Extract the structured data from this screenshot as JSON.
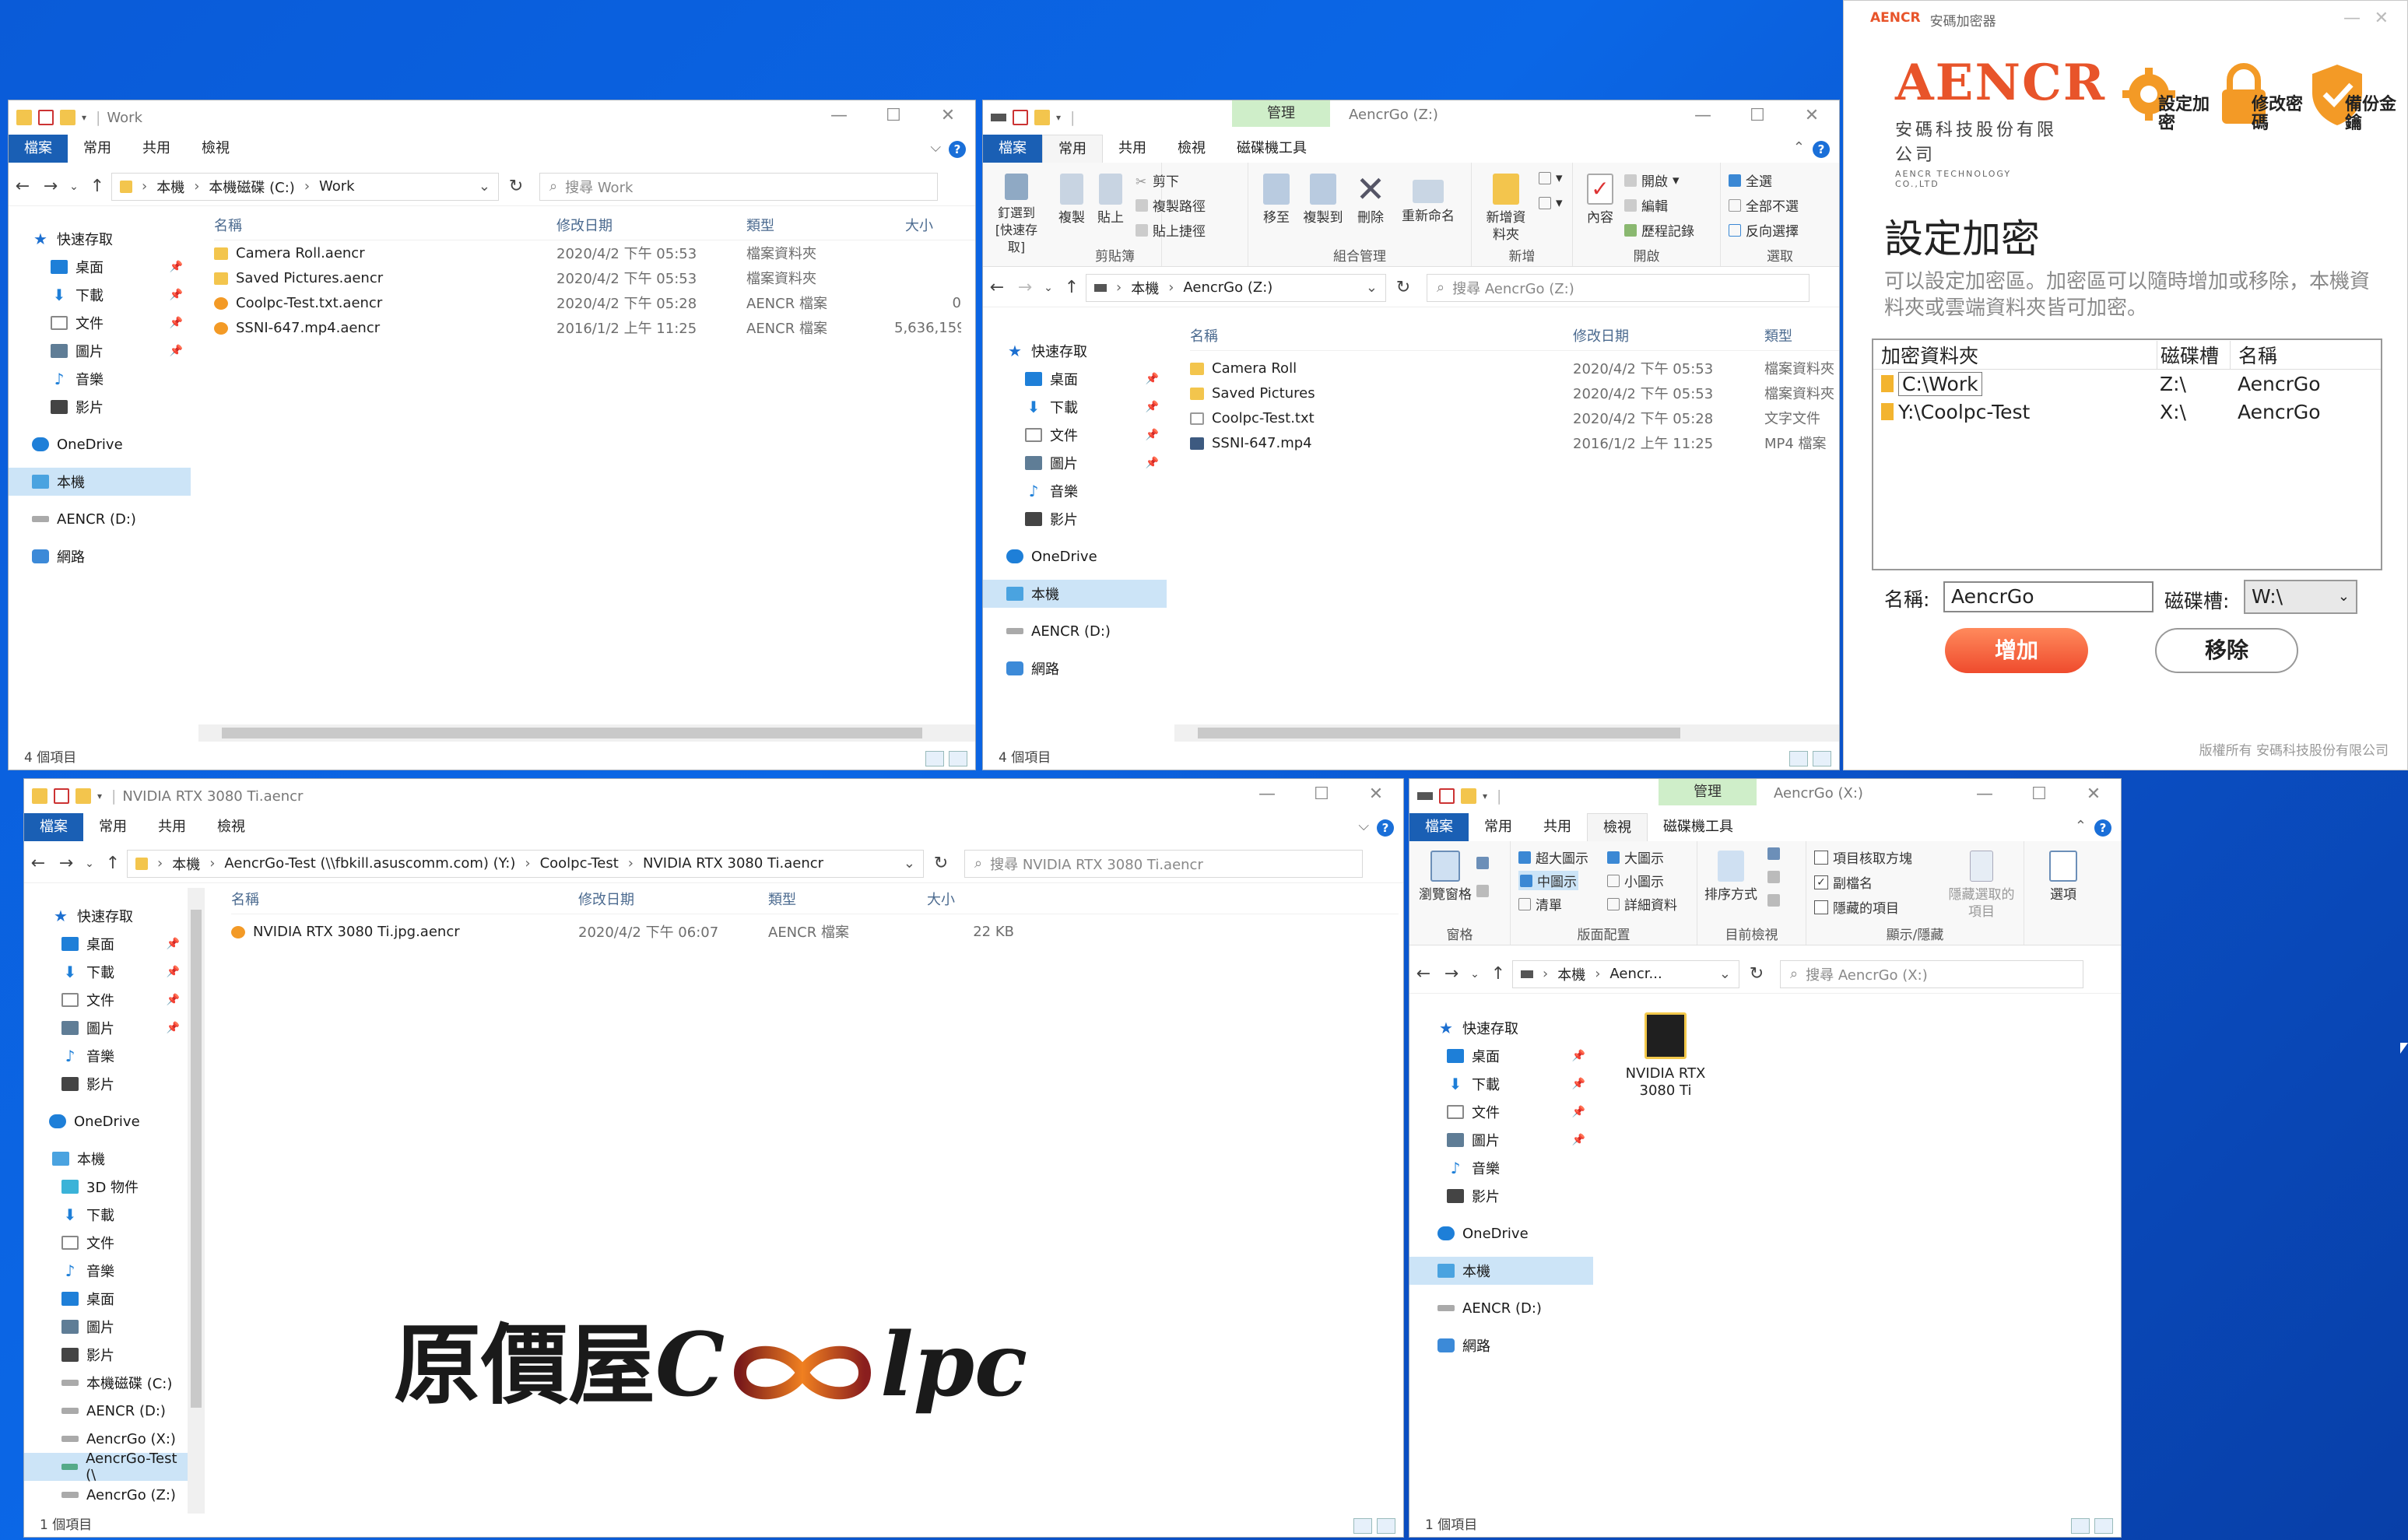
{
  "common": {
    "tab_file": "檔案",
    "tab_home": "常用",
    "tab_share": "共用",
    "tab_view": "檢視",
    "manage": "管理",
    "drive_tools": "磁碟機工具",
    "col_name": "名稱",
    "col_date": "修改日期",
    "col_type": "類型",
    "col_size": "大小",
    "nav_quick": "快速存取",
    "nav_desktop": "桌面",
    "nav_downloads": "下載",
    "nav_docs": "文件",
    "nav_pics": "圖片",
    "nav_music": "音樂",
    "nav_videos": "影片",
    "nav_onedrive": "OneDrive",
    "nav_pc": "本機",
    "nav_aencr_d": "AENCR (D:)",
    "nav_network": "網路",
    "items4": "4 個項目",
    "items1": "1 個項目"
  },
  "win1": {
    "title": "Work",
    "breadcrumb": [
      "本機",
      "本機磁碟 (C:)",
      "Work"
    ],
    "search_placeholder": "搜尋 Work",
    "files": [
      {
        "name": "Camera Roll.aencr",
        "date": "2020/4/2 下午 05:53",
        "type": "檔案資料夾",
        "size": "",
        "icon": "folder"
      },
      {
        "name": "Saved Pictures.aencr",
        "date": "2020/4/2 下午 05:53",
        "type": "檔案資料夾",
        "size": "",
        "icon": "folder"
      },
      {
        "name": "Coolpc-Test.txt.aencr",
        "date": "2020/4/2 下午 05:28",
        "type": "AENCR 檔案",
        "size": "0",
        "icon": "aen"
      },
      {
        "name": "SSNI-647.mp4.aencr",
        "date": "2016/1/2 上午 11:25",
        "type": "AENCR 檔案",
        "size": "5,636,159",
        "icon": "aen"
      }
    ]
  },
  "win2": {
    "title": "AencrGo (Z:)",
    "breadcrumb": [
      "本機",
      "AencrGo (Z:)"
    ],
    "search_placeholder": "搜尋 AencrGo (Z:)",
    "ribbon": {
      "pin": "釘選到 [快速存取]",
      "copy": "複製",
      "paste": "貼上",
      "cut": "剪下",
      "copy_path": "複製路徑",
      "paste_shortcut": "貼上捷徑",
      "move_to": "移至",
      "copy_to": "複製到",
      "delete": "刪除",
      "rename": "重新命名",
      "new_folder": "新增資料夾",
      "properties": "內容",
      "open": "開啟",
      "edit": "編輯",
      "history": "歷程記錄",
      "select_all": "全選",
      "select_none": "全部不選",
      "invert": "反向選擇",
      "g_clipboard": "剪貼簿",
      "g_organize": "組合管理",
      "g_new": "新增",
      "g_open": "開啟",
      "g_select": "選取"
    },
    "files": [
      {
        "name": "Camera Roll",
        "date": "2020/4/2 下午 05:53",
        "type": "檔案資料夾",
        "icon": "folder"
      },
      {
        "name": "Saved Pictures",
        "date": "2020/4/2 下午 05:53",
        "type": "檔案資料夾",
        "icon": "folder"
      },
      {
        "name": "Coolpc-Test.txt",
        "date": "2020/4/2 下午 05:28",
        "type": "文字文件",
        "icon": "txt"
      },
      {
        "name": "SSNI-647.mp4",
        "date": "2016/1/2 上午 11:25",
        "type": "MP4 檔案",
        "icon": "mp4"
      }
    ]
  },
  "win3": {
    "title": "NVIDIA RTX 3080 Ti.aencr",
    "breadcrumb": [
      "本機",
      "AencrGo-Test (\\\\fbkill.asuscomm.com) (Y:)",
      "Coolpc-Test",
      "NVIDIA RTX 3080 Ti.aencr"
    ],
    "search_placeholder": "搜尋 NVIDIA RTX 3080 Ti.aencr",
    "files": [
      {
        "name": "NVIDIA RTX 3080 Ti.jpg.aencr",
        "date": "2020/4/2 下午 06:07",
        "type": "AENCR 檔案",
        "size": "22 KB",
        "icon": "aen"
      }
    ],
    "tree_extra": {
      "objects3d": "3D 物件",
      "local_c": "本機磁碟 (C:)",
      "aencrgo_x": "AencrGo (X:)",
      "aencrgo_test": "AencrGo-Test (\\",
      "aencrgo_z": "AencrGo (Z:)"
    },
    "watermark_zh": "原價屋",
    "watermark_en_c": "C",
    "watermark_en_lpc": "lpc"
  },
  "win4": {
    "title": "AencrGo (X:)",
    "breadcrumb": [
      "本機",
      "Aencr..."
    ],
    "search_placeholder": "搜尋 AencrGo (X:)",
    "ribbon": {
      "nav_pane": "瀏覽窗格",
      "xl_icons": "超大圖示",
      "l_icons": "大圖示",
      "m_icons": "中圖示",
      "s_icons": "小圖示",
      "list": "清單",
      "details": "詳細資料",
      "sort": "排序方式",
      "item_checkbox": "項目核取方塊",
      "extensions": "副檔名",
      "hidden_items": "隱藏的項目",
      "hide_selected": "隱藏選取的項目",
      "options": "選項",
      "g_pane": "窗格",
      "g_layout": "版面配置",
      "g_current": "目前檢視",
      "g_showhide": "顯示/隱藏"
    },
    "file": {
      "name": "NVIDIA RTX 3080 Ti"
    }
  },
  "aencr": {
    "window_title": "安碼加密器",
    "logo_text": "AENCR",
    "logo_zh": "安碼科技股份有限公司",
    "logo_en": "AENCR TECHNOLOGY CO.,LTD",
    "btn_set": "設定加密",
    "btn_change": "修改密碼",
    "btn_backup": "備份金鑰",
    "heading": "設定加密",
    "description": "可以設定加密區。加密區可以隨時增加或移除，本機資料夾或雲端資料夾皆可加密。",
    "col_folder": "加密資料夾",
    "col_drive": "磁碟槽",
    "col_name": "名稱",
    "rows": [
      {
        "folder": "C:\\Work",
        "drive": "Z:\\",
        "name": "AencrGo"
      },
      {
        "folder": "Y:\\Coolpc-Test",
        "drive": "X:\\",
        "name": "AencrGo"
      }
    ],
    "name_label": "名稱:",
    "name_value": "AencrGo",
    "drive_label": "磁碟槽:",
    "drive_value": "W:\\",
    "add": "增加",
    "remove": "移除",
    "copyright": "版權所有 安碼科技股份有限公司",
    "brand_color": "#e8542a"
  }
}
